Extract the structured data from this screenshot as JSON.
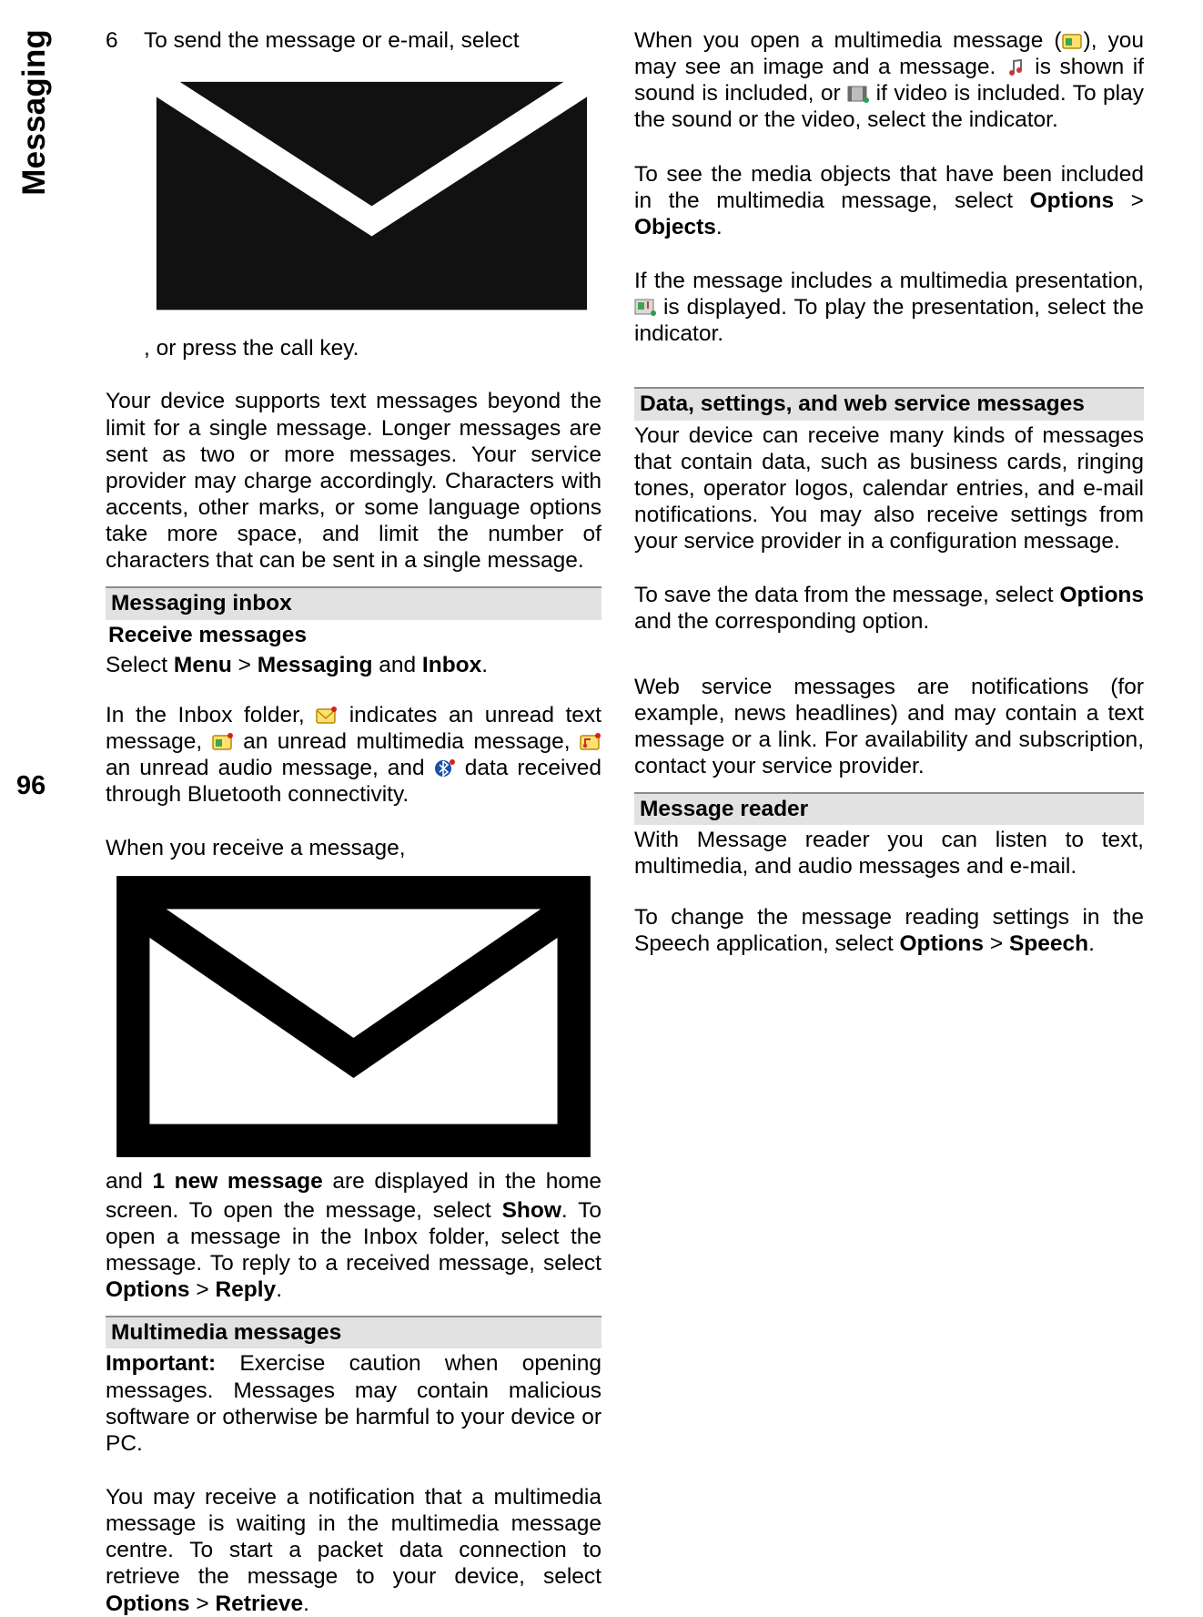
{
  "side": {
    "section_title": "Messaging",
    "page_number": "96"
  },
  "left": {
    "step6_num": "6",
    "step6_a": "To send the message or e-mail, select ",
    "step6_b": ", or press the call key.",
    "long_msg": "Your device supports text messages beyond the limit for a single message. Longer messages are sent as two or more messages. Your service provider may charge accordingly. Characters with accents, other marks, or some language options take more space, and limit the number of characters that can be sent in a single message.",
    "inbox_header": "Messaging inbox",
    "receive_header": "Receive messages",
    "select_1": "Select ",
    "menu": "Menu",
    "gt": "  > ",
    "messaging_word": "Messaging",
    "and_word": " and ",
    "inbox_word": "Inbox",
    "period": ".",
    "inbox_p1_a": "In the Inbox folder, ",
    "inbox_p1_b": " indicates an unread text message, ",
    "inbox_p1_c": " an unread multimedia message, ",
    "inbox_p1_d": " an unread audio message, and ",
    "inbox_p1_e": " data received through Bluetooth connectivity.",
    "recv_a": "When you receive a message, ",
    "recv_b": " and ",
    "new_msg": "1 new message",
    "recv_c": " are displayed in the home screen. To open the message, select ",
    "show": "Show",
    "recv_d": ". To open a message in the Inbox folder, select the message. To reply to a received message, select ",
    "options": "Options",
    "reply": "Reply",
    "mm_header": "Multimedia messages",
    "important": "Important:",
    "mm_caution": "  Exercise caution when opening messages. Messages may contain malicious software or otherwise be harmful to your device or PC.",
    "mm_p2_a": "You may receive a notification that a multimedia message is waiting in the multimedia message centre. To start a packet data connection to retrieve the message to your device, select ",
    "retrieve": "Retrieve"
  },
  "right": {
    "open_a": "When you open a multimedia message (",
    "open_b": "), you may see an image and a message. ",
    "open_c": " is shown if sound is included, or ",
    "open_d": " if video is included. To play the sound or the video, select the indicator.",
    "media_a": "To see the media objects that have been included in the multimedia message, select ",
    "objects": "Objects",
    "pres_a": "If the message includes a multimedia presentation, ",
    "pres_b": " is displayed. To play the presentation, select the indicator.",
    "data_header": "Data, settings, and web service messages",
    "data_p1": "Your device can receive many kinds of messages that contain data, such as business cards, ringing tones, operator logos, calendar entries, and e-mail notifications. You may also receive settings from your service provider in a configuration message.",
    "data_p2_a": "To save the data from the message, select ",
    "data_p2_b": " and the corresponding option.",
    "web_p": "Web service messages are notifications (for example, news headlines) and may contain a text message or a link. For availability and subscription, contact your service provider.",
    "reader_header": "Message reader",
    "reader_p1": "With Message reader you can listen to text, multimedia, and audio messages and e-mail.",
    "reader_p2_a": "To change the message reading settings in the Speech application, select ",
    "speech": "Speech"
  }
}
